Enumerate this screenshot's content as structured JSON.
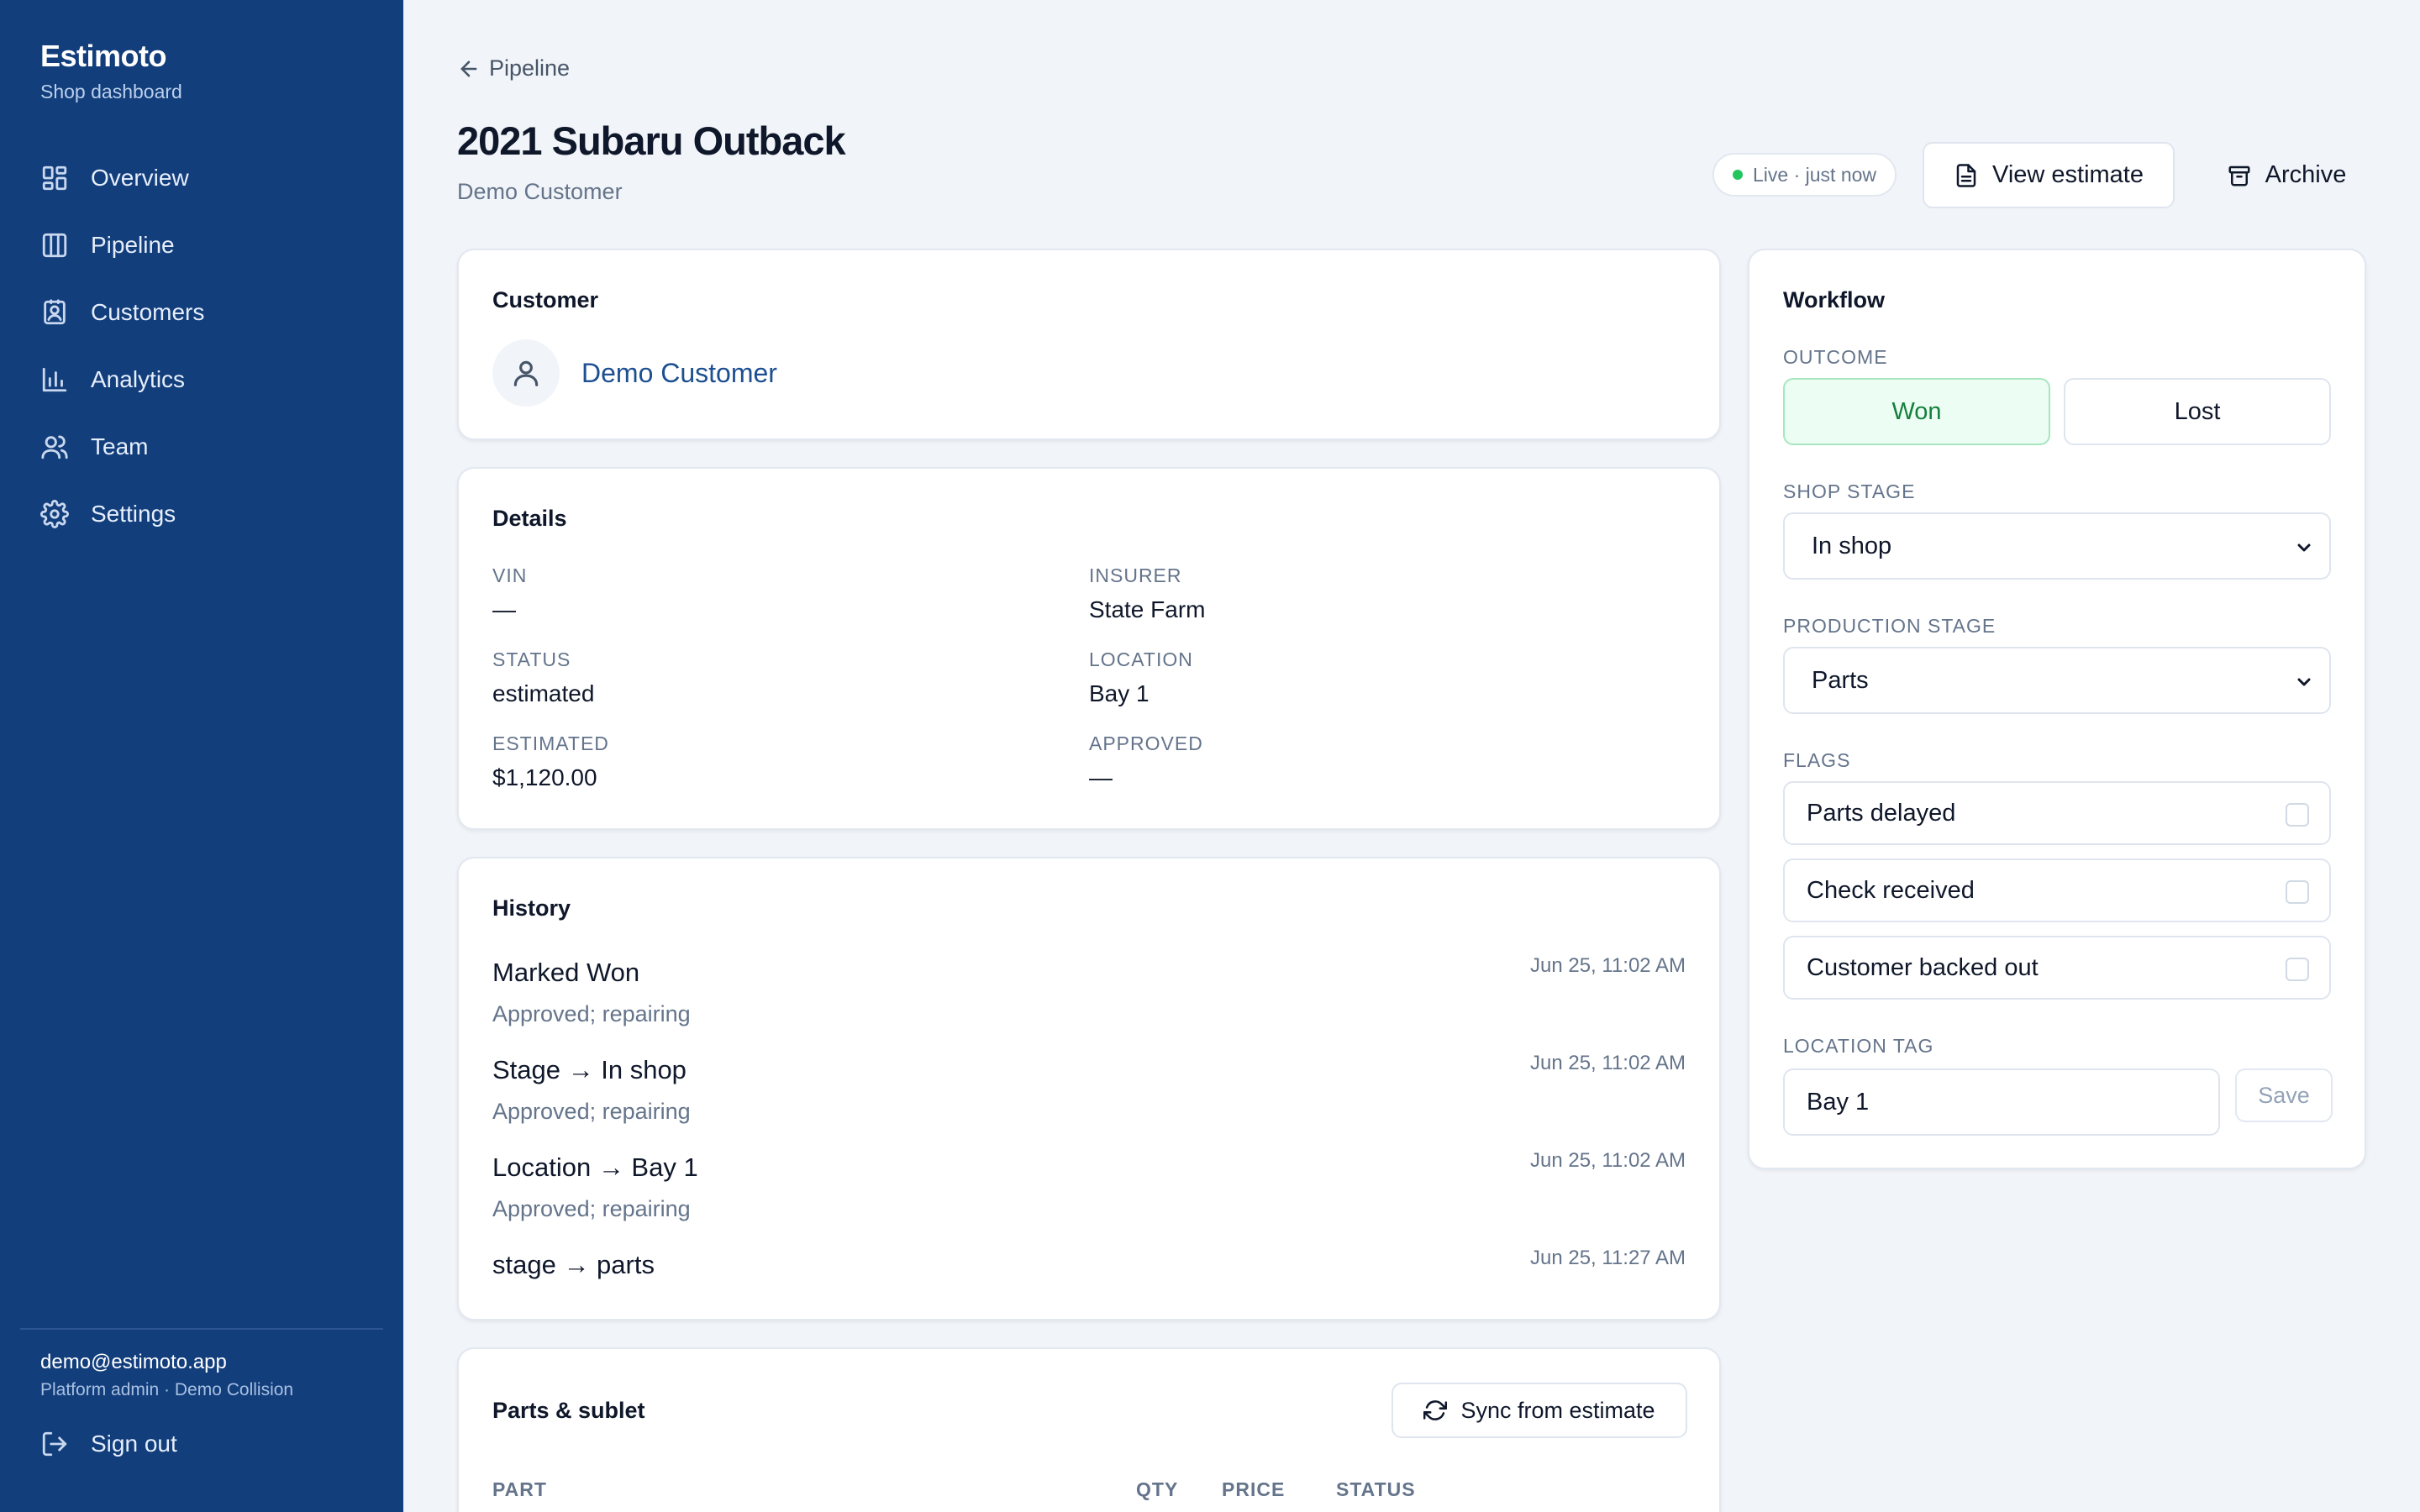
{
  "app": {
    "name": "Estimoto",
    "subtitle": "Shop dashboard"
  },
  "nav": [
    {
      "label": "Overview",
      "icon": "grid-icon"
    },
    {
      "label": "Pipeline",
      "icon": "columns-icon"
    },
    {
      "label": "Customers",
      "icon": "contact-card-icon"
    },
    {
      "label": "Analytics",
      "icon": "bar-chart-icon"
    },
    {
      "label": "Team",
      "icon": "users-icon"
    },
    {
      "label": "Settings",
      "icon": "gear-icon"
    }
  ],
  "user": {
    "email": "demo@estimoto.app",
    "role": "Platform admin · Demo Collision",
    "signout_label": "Sign out"
  },
  "header": {
    "back_label": "Pipeline",
    "title": "2021 Subaru Outback",
    "subtitle": "Demo Customer",
    "live_status": "Live · just now",
    "view_estimate_label": "View estimate",
    "archive_label": "Archive",
    "live_color": "#22c55e"
  },
  "customer": {
    "title": "Customer",
    "name": "Demo Customer"
  },
  "details": {
    "title": "Details",
    "vin_label": "VIN",
    "vin": "—",
    "insurer_label": "INSURER",
    "insurer": "State Farm",
    "status_label": "STATUS",
    "status": "estimated",
    "location_label": "LOCATION",
    "location": "Bay 1",
    "estimated_label": "ESTIMATED",
    "estimated": "$1,120.00",
    "approved_label": "APPROVED",
    "approved": "—"
  },
  "history": {
    "title": "History",
    "entries": [
      {
        "title": "Marked Won",
        "note": "Approved; repairing",
        "time": "Jun 25, 11:02 AM"
      },
      {
        "title": "Stage → In shop",
        "note": "Approved; repairing",
        "time": "Jun 25, 11:02 AM"
      },
      {
        "title": "Location → Bay 1",
        "note": "Approved; repairing",
        "time": "Jun 25, 11:02 AM"
      },
      {
        "title": "stage → parts",
        "note": "",
        "time": "Jun 25, 11:27 AM"
      }
    ]
  },
  "parts": {
    "title": "Parts & sublet",
    "sync_label": "Sync from estimate",
    "columns": [
      "PART",
      "QTY",
      "PRICE",
      "STATUS"
    ]
  },
  "workflow": {
    "title": "Workflow",
    "outcome_label": "OUTCOME",
    "won_label": "Won",
    "lost_label": "Lost",
    "shop_stage_label": "SHOP STAGE",
    "shop_stage_value": "In shop",
    "production_stage_label": "PRODUCTION STAGE",
    "production_stage_value": "Parts",
    "flags_label": "FLAGS",
    "flags": [
      "Parts delayed",
      "Check received",
      "Customer backed out"
    ],
    "location_tag_label": "LOCATION TAG",
    "location_tag_value": "Bay 1",
    "save_label": "Save"
  },
  "colors": {
    "sidebar": "#123e7c",
    "accent": "#1d4f91",
    "won": "#15803d"
  }
}
